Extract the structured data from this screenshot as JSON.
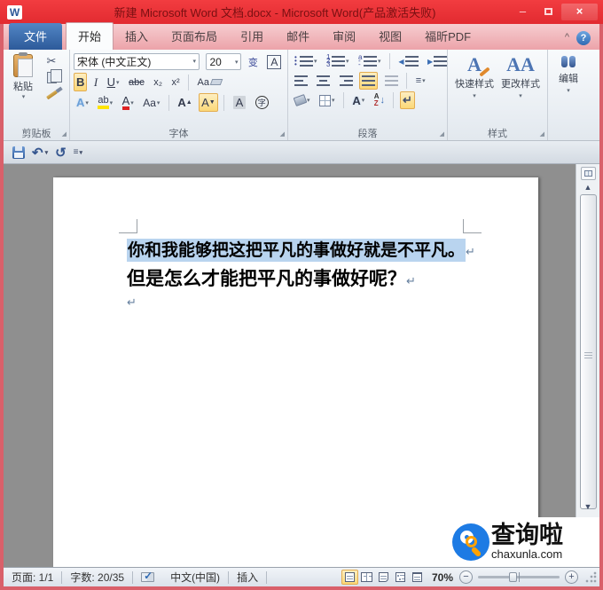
{
  "titlebar": {
    "app_initial": "W",
    "title": "新建 Microsoft Word 文档.docx - Microsoft Word(产品激活失败)",
    "minimize": "–",
    "close": "×"
  },
  "tabs": {
    "file": "文件",
    "active": "开始",
    "items": [
      "开始",
      "插入",
      "页面布局",
      "引用",
      "邮件",
      "审阅",
      "视图",
      "福昕PDF"
    ],
    "collapse": "^",
    "help": "?"
  },
  "ribbon": {
    "clipboard": {
      "label": "剪贴板",
      "paste": "粘贴"
    },
    "font": {
      "label": "字体",
      "name_value": "宋体 (中文正文)",
      "size_value": "20",
      "phonetic": "变",
      "char_border": "A",
      "bold": "B",
      "italic": "I",
      "underline": "U",
      "strikethrough": "abc",
      "subscript": "x₂",
      "superscript": "x²",
      "clear_format": "Aa",
      "text_effects": "A",
      "highlight": "ab",
      "font_color": "A",
      "change_case": "Aa",
      "grow": "A",
      "grow_mark": "▲",
      "shrink": "A",
      "shrink_mark": "▼",
      "char_shading": "A",
      "enclose": "字"
    },
    "paragraph": {
      "label": "段落",
      "sort_a": "A",
      "sort_z": "Z",
      "sort_arrow": "↓",
      "show_hide": "↵",
      "spacing": "≡"
    },
    "styles": {
      "label": "样式",
      "quick": "快速样式",
      "change": "更改样式",
      "quick_glyph": "A",
      "change_glyph": "AA"
    },
    "editing": {
      "label": "编辑"
    },
    "dropdown": "▾",
    "launcher": "◢"
  },
  "qat": {
    "undo": "↶",
    "redo": "↺",
    "customize": "≡"
  },
  "document": {
    "line1": "你和我能够把这把平凡的事做好就是不平凡。",
    "line2": "但是怎么才能把平凡的事做好呢？",
    "pilcrow": "↵"
  },
  "scrollbar": {
    "up": "▲",
    "down": "▼"
  },
  "watermark": {
    "name": "查询啦",
    "url": "chaxunla.com"
  },
  "statusbar": {
    "page": "页面: 1/1",
    "words": "字数: 20/35",
    "language": "中文(中国)",
    "mode": "插入",
    "zoom": "70%",
    "zoom_out": "−",
    "zoom_in": "+"
  }
}
